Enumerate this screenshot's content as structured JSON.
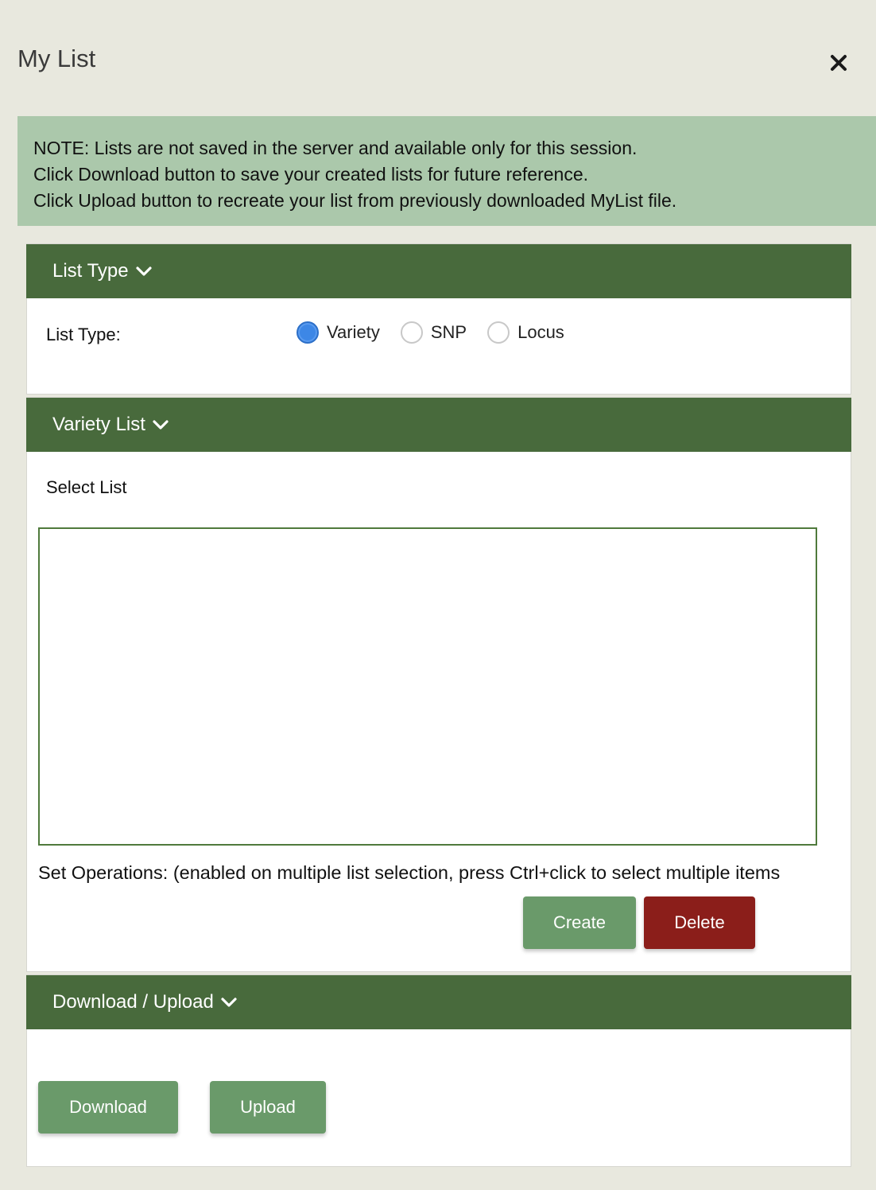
{
  "panel": {
    "title": "My List"
  },
  "note": {
    "lines": [
      "NOTE: Lists are not saved in the server and available only for this session.",
      "Click Download button to save your created lists for future reference.",
      "Click Upload button to recreate your list from previously downloaded MyList file."
    ]
  },
  "list_type_section": {
    "header": "List Type",
    "field_label": "List Type:",
    "options": [
      "Variety",
      "SNP",
      "Locus"
    ],
    "selected": "Variety"
  },
  "variety_list_section": {
    "header": "Variety List",
    "select_label": "Select List",
    "set_operations_text": "Set Operations: (enabled on multiple list selection, press Ctrl+click to select multiple items",
    "create_label": "Create",
    "delete_label": "Delete"
  },
  "download_upload_section": {
    "header": "Download / Upload",
    "download_label": "Download",
    "upload_label": "Upload"
  },
  "colors": {
    "header_green": "#486a3c",
    "note_green": "#abc8ab",
    "button_green": "#6a9a6a",
    "delete_red": "#8b1e1a",
    "radio_blue": "#3d87e6"
  }
}
